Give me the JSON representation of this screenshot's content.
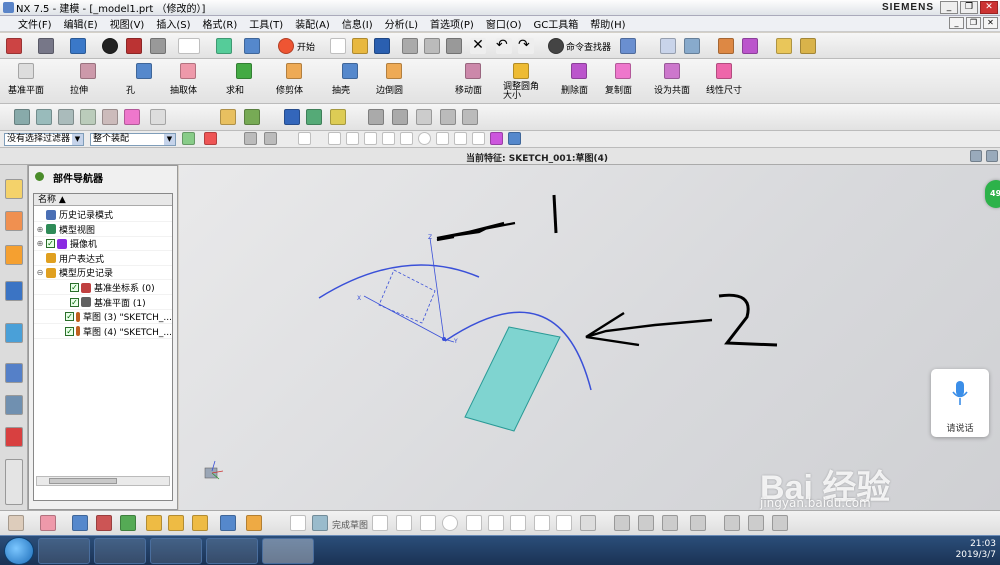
{
  "window": {
    "title": "NX 7.5 - 建模 - [_model1.prt （修改的）]",
    "brand": "SIEMENS",
    "minimize": "_",
    "restore": "❐",
    "close": "✕"
  },
  "menu": {
    "items": [
      "文件(F)",
      "编辑(E)",
      "视图(V)",
      "插入(S)",
      "格式(R)",
      "工具(T)",
      "装配(A)",
      "信息(I)",
      "分析(L)",
      "首选项(P)",
      "窗口(O)",
      "GC工具箱",
      "帮助(H)"
    ]
  },
  "toolbar1": {
    "start_label": "开始",
    "command_finder_label": "命令查找器"
  },
  "toolbar2": {
    "left_items": [
      "基准平面",
      "拉伸",
      "孔",
      "抽取体",
      "求和",
      "修剪体",
      "抽壳",
      "边倒圆"
    ],
    "right_items": [
      "移动面",
      "调整圆角大小",
      "删除面",
      "复制面",
      "设为共面",
      "线性尺寸"
    ]
  },
  "filterbar": {
    "selection_filter": "没有选择过滤器",
    "assembly_scope": "整个装配"
  },
  "statusline": {
    "current_feature": "当前特征: SKETCH_001:草图(4)"
  },
  "navigator": {
    "title": "部件导航器",
    "column_header": "名称",
    "rows": [
      {
        "label": "历史记录模式",
        "indent": 1,
        "toggle": "",
        "checked": false,
        "icon_color": "#4a6fb5"
      },
      {
        "label": "模型视图",
        "indent": 1,
        "toggle": "⊕",
        "checked": false,
        "icon_color": "#2e8b57"
      },
      {
        "label": "摄像机",
        "indent": 1,
        "toggle": "⊕",
        "checked": true,
        "icon_color": "#8a2be2"
      },
      {
        "label": "用户表达式",
        "indent": 1,
        "toggle": "",
        "checked": false,
        "icon_color": "#e0a020"
      },
      {
        "label": "模型历史记录",
        "indent": 1,
        "toggle": "⊖",
        "checked": false,
        "icon_color": "#e0a020"
      },
      {
        "label": "基准坐标系 (0)",
        "indent": 2,
        "toggle": "",
        "checked": true,
        "icon_color": "#c04040"
      },
      {
        "label": "基准平面 (1)",
        "indent": 2,
        "toggle": "",
        "checked": true,
        "icon_color": "#606060"
      },
      {
        "label": "草图 (3) \"SKETCH_...",
        "indent": 2,
        "toggle": "",
        "checked": true,
        "icon_color": "#c06020"
      },
      {
        "label": "草图 (4) \"SKETCH_...",
        "indent": 2,
        "toggle": "",
        "checked": true,
        "icon_color": "#c06020"
      }
    ]
  },
  "canvas": {
    "annotation_1": "1",
    "annotation_2": "2",
    "axis_x": "X",
    "axis_y": "Y",
    "axis_z": "Z"
  },
  "bottombar": {
    "finish_sketch_label": "完成草图"
  },
  "voice_card": {
    "label": "请说话"
  },
  "green_badge": "49",
  "watermark": {
    "text": "Bai 经验",
    "url": "jingyan.baidu.com"
  },
  "taskbar": {
    "time": "21:03",
    "date": "2019/3/7"
  },
  "colors": {
    "curve_blue": "#3a50d8",
    "plane_teal": "#7fd4d0",
    "ink": "#000000",
    "taskbar": "#1a3254"
  }
}
